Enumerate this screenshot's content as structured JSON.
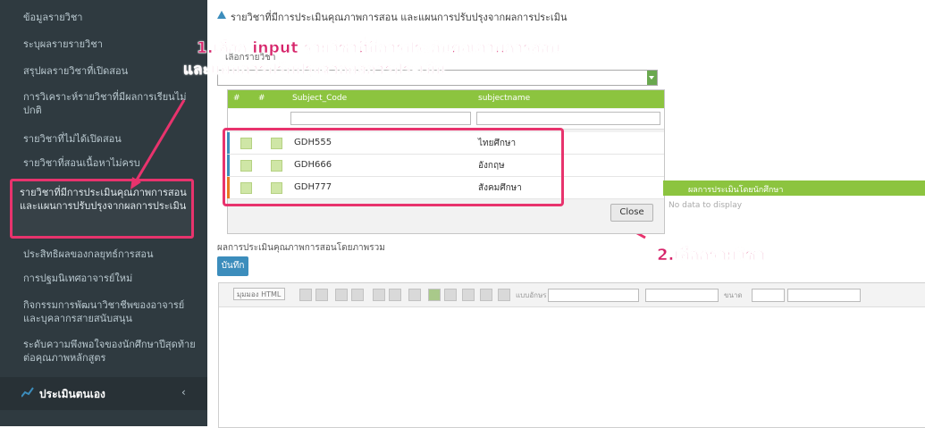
{
  "sidebar": {
    "items": [
      {
        "label": "ข้อมูลรายวิชา"
      },
      {
        "label": "ระบุผลรายรายวิชา"
      },
      {
        "label": "สรุปผลรายวิชาที่เปิดสอน"
      },
      {
        "label": "การวิเคราะห์รายวิชาที่มีผลการเรียนไม่ปกติ"
      },
      {
        "label": "รายวิชาที่ไม่ได้เปิดสอน"
      },
      {
        "label": "รายวิชาที่สอนเนื้อหาไม่ครบ"
      },
      {
        "label": "รายวิชาที่มีการประเมินคุณภาพการสอน และแผนการปรับปรุงจากผลการประเมิน"
      },
      {
        "label": "ประสิทธิผลของกลยุทธ์การสอน"
      },
      {
        "label": "การปฐมนิเทศอาจารย์ใหม่"
      },
      {
        "label": "กิจกรรมการพัฒนาวิชาชีพของอาจารย์และบุคลากรสายสนับสนุน"
      },
      {
        "label": "ระดับความพึงพอใจของนักศึกษาปีสุดท้ายต่อคุณภาพหลักสูตร"
      }
    ],
    "footer_label": "ประเมินตนเอง",
    "footer_chevron": "‹"
  },
  "main": {
    "heading": "รายวิชาที่มีการประเมินคุณภาพการสอน และแผนการปรับปรุงจากผลการประเมิน",
    "field_label": "เลือกรายวิชา",
    "grid": {
      "headers": [
        "#",
        "#",
        "Subject_Code",
        "subjectname"
      ],
      "rows": [
        {
          "code": "GDH555",
          "name": "ไทยศึกษา"
        },
        {
          "code": "GDH666",
          "name": "อังกฤษ"
        },
        {
          "code": "GDH777",
          "name": "สังคมศึกษา"
        }
      ],
      "close_label": "Close"
    },
    "right_panel": {
      "header": "ผลการประเมินโดยนักศึกษา",
      "empty_text": "No data to display"
    },
    "section_label": "ผลการประเมินคุณภาพการสอนโดยภาพรวม",
    "save_label": "บันทึก",
    "editor": {
      "source_label": "มุมมอง HTML",
      "font_label": "แบบอักษร",
      "size_label": "ขนาด"
    }
  },
  "annotations": {
    "step1_line1": "1.เลือก input รายวิชาที่มีการประกันคุณภาพการสอน",
    "step1_line2": "และแผนการปรับปรุงจากผลการประเมิน",
    "step2": "2.เลือกรายวิชา"
  },
  "colors": {
    "accent_green": "#8cc43f",
    "annotation_pink": "#e8336d",
    "sidebar_bg": "#2f3a40",
    "primary_blue": "#3c8dbc"
  }
}
